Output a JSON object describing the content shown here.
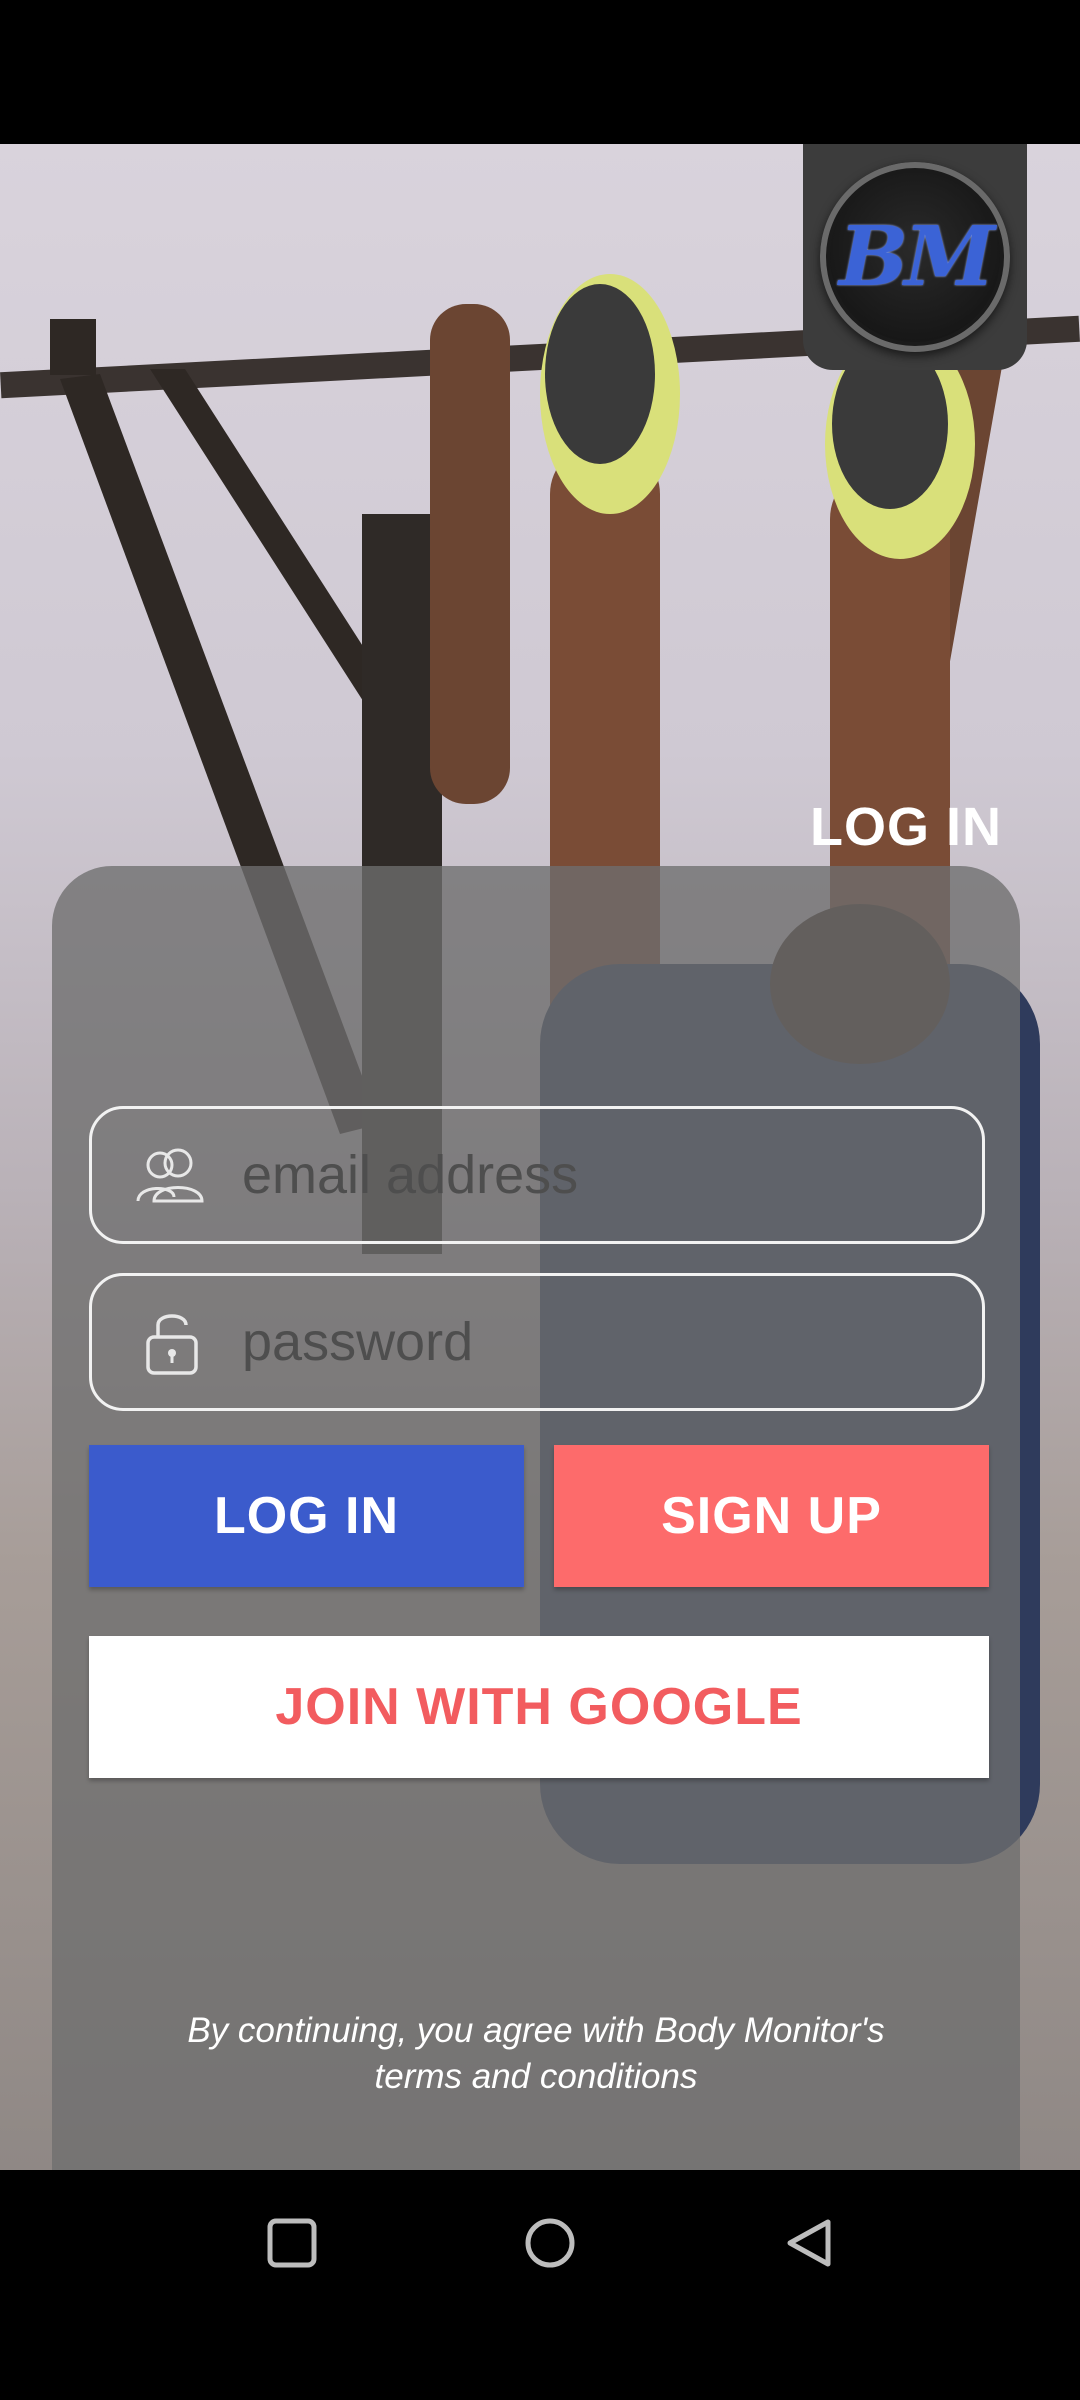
{
  "app": {
    "logo_text": "BM"
  },
  "header": {
    "login_label": "LOG IN"
  },
  "form": {
    "email": {
      "placeholder": "email address",
      "icon": "users-icon"
    },
    "password": {
      "placeholder": "password",
      "icon": "padlock-icon"
    }
  },
  "buttons": {
    "login_label": "LOG IN",
    "signup_label": "SIGN UP",
    "google_label": "JOIN WITH GOOGLE"
  },
  "terms": {
    "line1": "By continuing, you agree with Body Monitor's",
    "line2": "terms and conditions"
  },
  "navigation": {
    "recents": "square-icon",
    "home": "circle-icon",
    "back": "triangle-back-icon"
  },
  "colors": {
    "login_button": "#3b5bcc",
    "signup_button": "#fd6b6b",
    "google_text": "#f25c5f",
    "logo_accent": "#3b63d6"
  }
}
